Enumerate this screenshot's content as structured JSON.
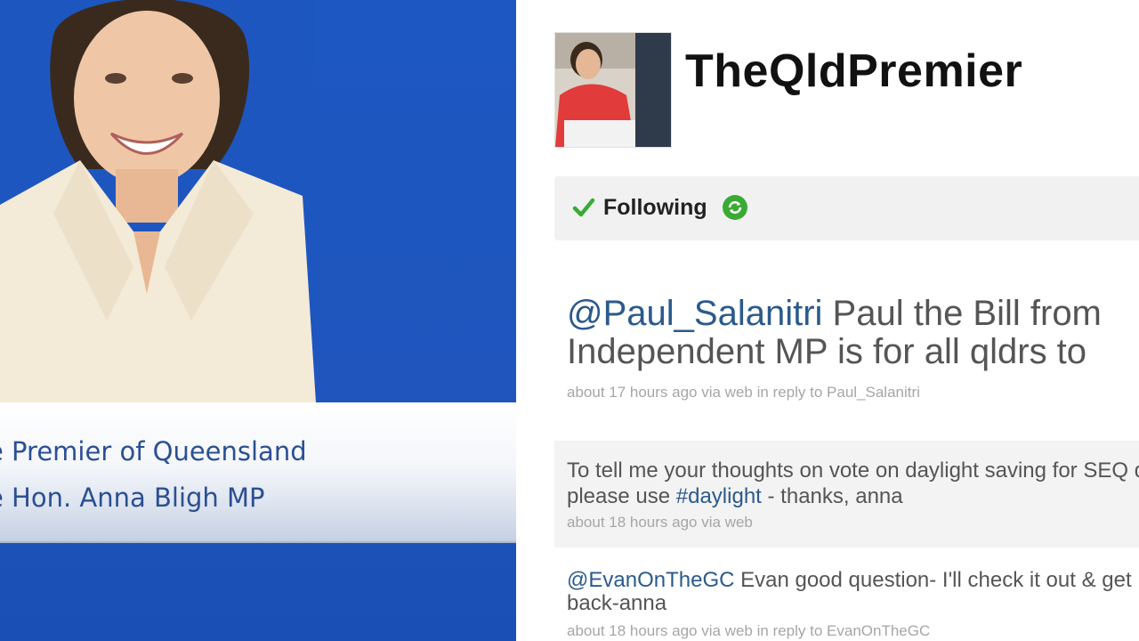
{
  "left": {
    "caption_line1": "e Premier of Queensland",
    "caption_line2": "e Hon. Anna Bligh MP"
  },
  "profile": {
    "username": "TheQldPremier",
    "follow_label": "Following",
    "icons": [
      "checkmark-icon",
      "refresh-icon"
    ],
    "colors": {
      "accent_green": "#3aaa35",
      "link": "#2b5a8c"
    }
  },
  "tweets": [
    {
      "mention": "@Paul_Salanitri",
      "line1_text": " Paul the Bill from",
      "line2_text": "Independent MP is for all qldrs to",
      "meta": "about 17 hours ago via web in reply to Paul_Salanitri"
    },
    {
      "line1_text": "To tell me your thoughts on vote on daylight saving for SEQ d",
      "line2_prefix": "please use ",
      "hashtag": "#daylight",
      "line2_suffix": " - thanks, anna",
      "meta": "about 18 hours ago via web"
    },
    {
      "mention": "@EvanOnTheGC",
      "line1_text": " Evan good question- I'll check it out & get",
      "line2_text": "back-anna",
      "meta": "about 18 hours ago via web in reply to EvanOnTheGC"
    }
  ]
}
